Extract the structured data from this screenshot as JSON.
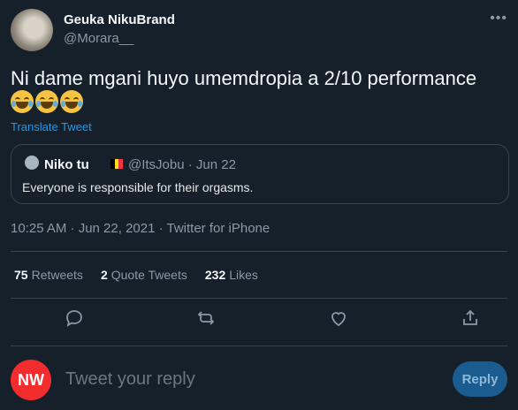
{
  "author": {
    "name": "Geuka NikuBrand",
    "handle": "@Morara__"
  },
  "tweet": {
    "text": "Ni dame mgani huyo umemdropia a 2/10 performance",
    "emoji": [
      "face-with-tears-of-joy",
      "face-with-tears-of-joy",
      "face-with-tears-of-joy"
    ],
    "translate_label": "Translate Tweet"
  },
  "quoted": {
    "name": "Niko tu",
    "flag": "belgium-flag",
    "handle_date": "@ItsJobu · Jun 22",
    "text": "Everyone is responsible for their orgasms."
  },
  "meta": {
    "timestamp": "10:25 AM · Jun 22, 2021 · Twitter for iPhone"
  },
  "stats": {
    "retweets_count": "75",
    "retweets_label": "Retweets",
    "quote_count": "2",
    "quote_label": "Quote Tweets",
    "likes_count": "232",
    "likes_label": "Likes"
  },
  "actions": [
    "reply-icon",
    "retweet-icon",
    "like-icon",
    "share-icon"
  ],
  "reply": {
    "avatar_text": "NW",
    "placeholder": "Tweet your reply",
    "button_label": "Reply"
  },
  "colors": {
    "background": "#15202b",
    "link": "#1d9bf0",
    "muted": "#8b98a5",
    "border": "#38444d",
    "reply_avatar": "#f32d2d"
  }
}
